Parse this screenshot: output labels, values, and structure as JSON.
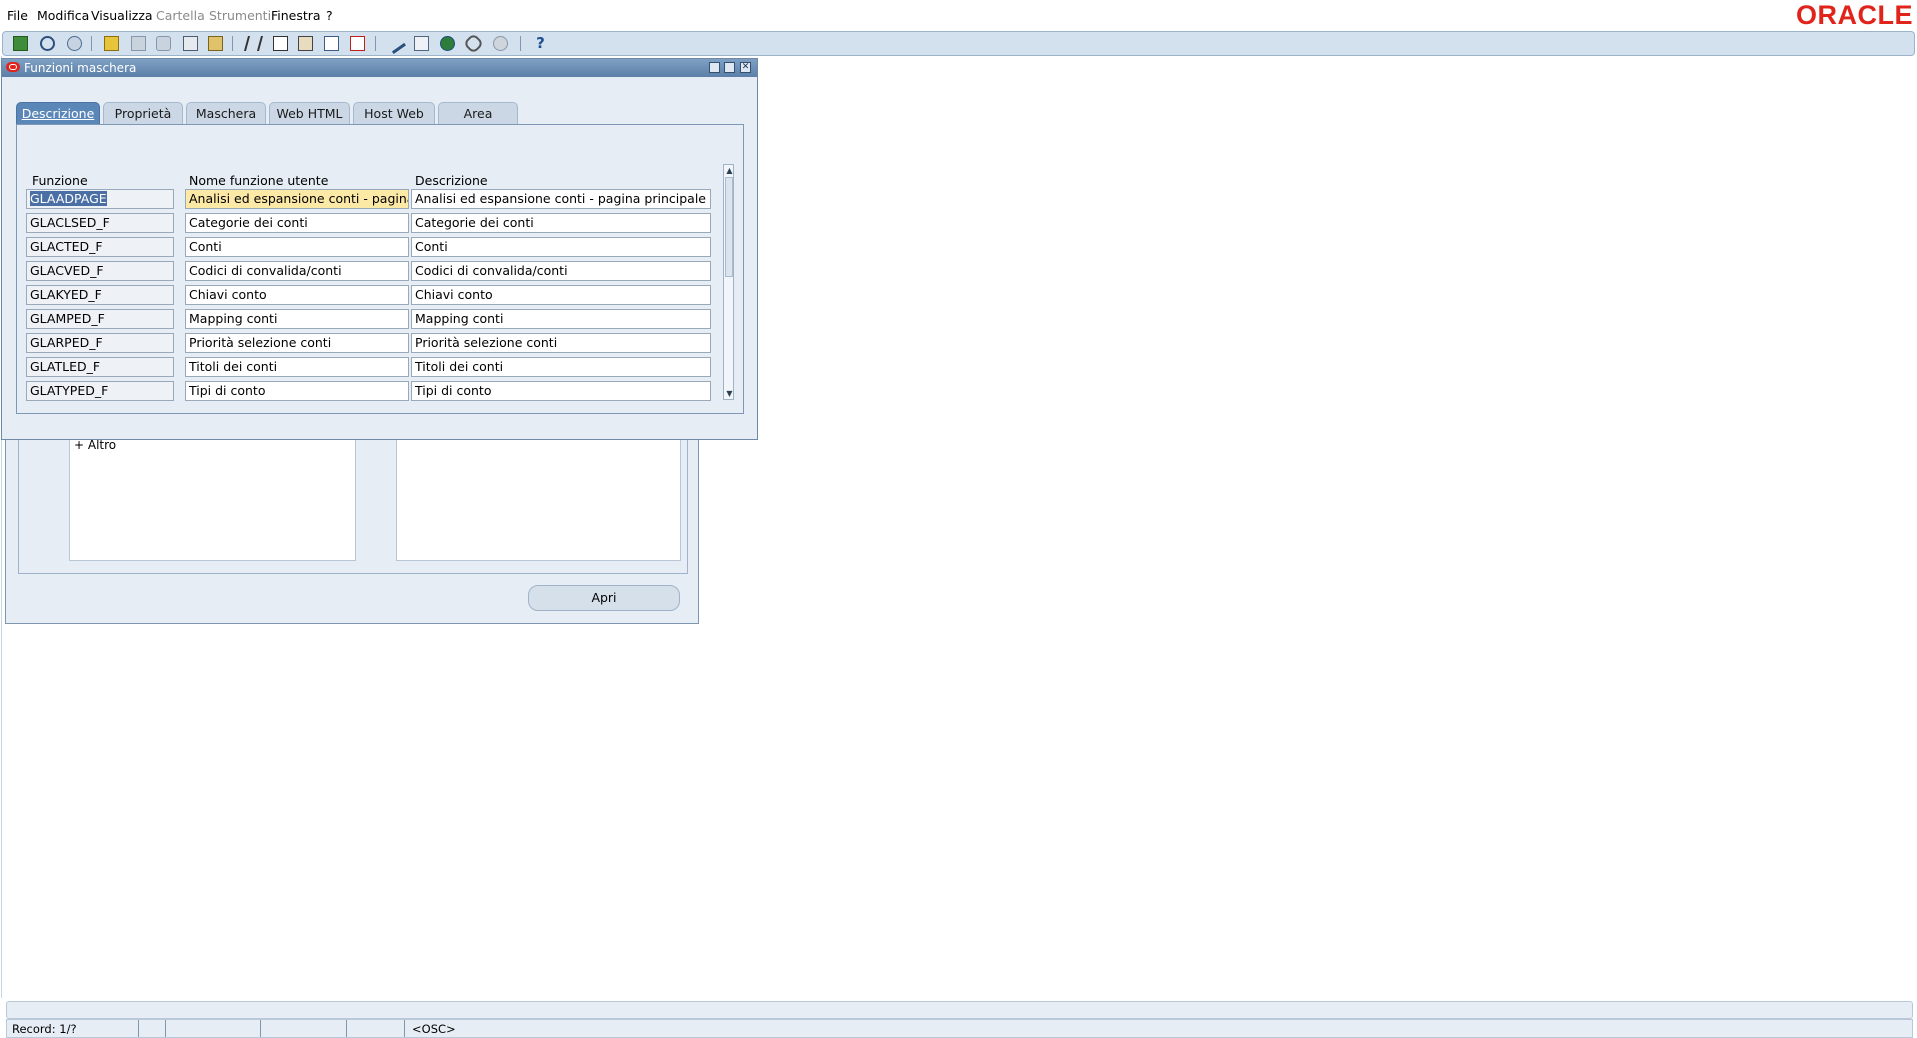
{
  "menu": {
    "items": [
      {
        "label": "File",
        "enabled": true
      },
      {
        "label": "Modifica",
        "enabled": true
      },
      {
        "label": "Visualizza",
        "enabled": true
      },
      {
        "label": "Cartella",
        "enabled": false
      },
      {
        "label": "Strumenti",
        "enabled": false
      },
      {
        "label": "Finestra",
        "enabled": true
      },
      {
        "label": "?",
        "enabled": true
      }
    ],
    "logo": "ORACLE"
  },
  "toolbar": {
    "icons": [
      "new-icon",
      "find-icon",
      "navigator-icon",
      "open-folder-icon",
      "save-icon",
      "print-icon",
      "close-form-icon",
      "cut-icon",
      "copy-icon",
      "paste-icon",
      "new-record-icon",
      "delete-record-icon",
      "edit-field-icon",
      "zoom-icon",
      "translations-icon",
      "attachments-icon",
      "folder-tools-icon",
      "help-icon"
    ]
  },
  "background_window": {
    "list_item": "+  Altro",
    "open_button": "Apri"
  },
  "dialog": {
    "title": "Funzioni maschera",
    "tabs": [
      "Descrizione",
      "Proprietà",
      "Maschera",
      "Web HTML",
      "Host Web",
      "Area"
    ],
    "active_tab": "Descrizione",
    "columns": [
      "Funzione",
      "Nome funzione utente",
      "Descrizione"
    ],
    "rows": [
      [
        "GLAADPAGE",
        "Analisi ed espansione conti - pagina principale",
        "Analisi ed espansione conti - pagina principale"
      ],
      [
        "GLACLSED_F",
        "Categorie dei conti",
        "Categorie dei conti"
      ],
      [
        "GLACTED_F",
        "Conti",
        "Conti"
      ],
      [
        "GLACVED_F",
        "Codici di convalida/conti",
        "Codici di convalida/conti"
      ],
      [
        "GLAKYED_F",
        "Chiavi conto",
        "Chiavi conto"
      ],
      [
        "GLAMPED_F",
        "Mapping conti",
        "Mapping conti"
      ],
      [
        "GLARPED_F",
        "Priorità selezione conti",
        "Priorità selezione conti"
      ],
      [
        "GLATLED_F",
        "Titoli dei conti",
        "Titoli dei conti"
      ],
      [
        "GLATYPED_F",
        "Tipi di conto",
        "Tipi di conto"
      ]
    ]
  },
  "status": {
    "record": "Record: 1/?",
    "mode": "<OSC>"
  },
  "colors": {
    "accent": "#5b86b8",
    "logo": "#e1241b",
    "focus_field": "#fde9a6",
    "panel": "#e6edf5"
  }
}
